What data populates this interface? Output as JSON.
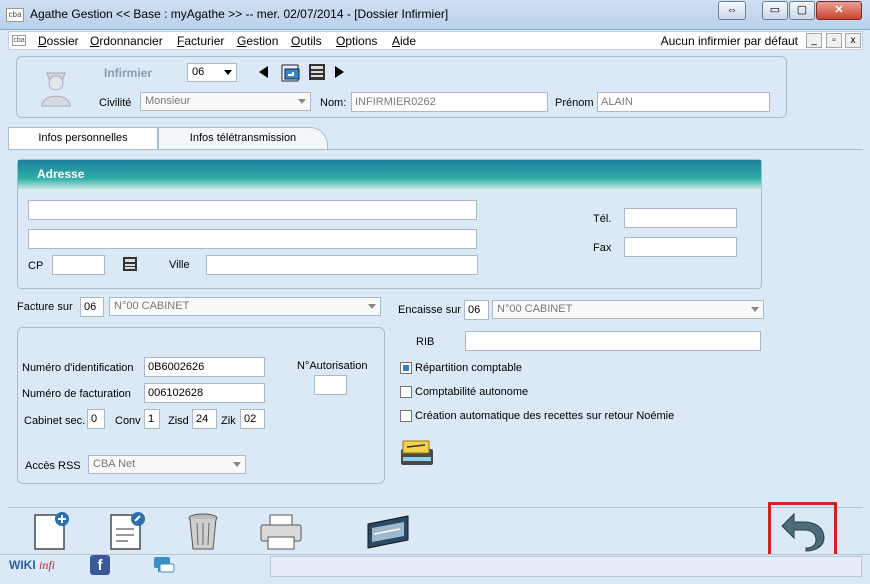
{
  "window": {
    "icon_text": "cba",
    "title": "Agathe Gestion << Base : myAgathe >>   --   mer. 02/07/2014  - [Dossier Infirmier]",
    "buttons": {
      "restore": "⇔",
      "minimize": "▭",
      "maximize": "▢",
      "close": "✕"
    }
  },
  "menubar": {
    "items": [
      {
        "first": "D",
        "rest": "ossier"
      },
      {
        "first": "O",
        "rest": "rdonnancier"
      },
      {
        "first": "F",
        "rest": "acturier"
      },
      {
        "first": "G",
        "rest": "estion"
      },
      {
        "first": "O",
        "rest": "utils"
      },
      {
        "first": "O",
        "rest": "ptions"
      },
      {
        "first": "A",
        "rest": "ide"
      }
    ],
    "right_label": "Aucun infirmier par défaut",
    "mdi": {
      "minimize": "_",
      "restore": "▫",
      "close": "x"
    }
  },
  "header": {
    "role_label": "Infirmier",
    "record_number": "06",
    "civilite_label": "Civilité",
    "civilite_value": "Monsieur",
    "nom_label": "Nom:",
    "nom_value": "INFIRMIER0262",
    "prenom_label": "Prénom",
    "prenom_value": "ALAIN"
  },
  "tabs": [
    {
      "label": "Infos personnelles",
      "active": true
    },
    {
      "label": "Infos télétransmission",
      "active": false
    }
  ],
  "adresse": {
    "title": "Adresse",
    "line1": "",
    "line2": "",
    "cp_label": "CP",
    "cp_value": "",
    "ville_label": "Ville",
    "ville_value": "",
    "tel_label": "Tél.",
    "tel_value": "",
    "fax_label": "Fax",
    "fax_value": ""
  },
  "facturation": {
    "facture_sur_label": "Facture sur",
    "facture_sur_code": "06",
    "facture_sur_value": "N°00  CABINET",
    "encaisse_sur_label": "Encaisse sur",
    "encaisse_sur_code": "06",
    "encaisse_sur_value": "N°00  CABINET",
    "rib_label": "RIB",
    "rib_value": ""
  },
  "identification": {
    "num_id_label": "Numéro d'identification",
    "num_id_value": "0B6002626",
    "num_fact_label": "Numéro de facturation",
    "num_fact_value": "006102628",
    "autorisation_label": "N°Autorisation",
    "autorisation_value": "",
    "cabinet_sec_label": "Cabinet sec.",
    "cabinet_sec_value": "0",
    "conv_label": "Conv",
    "conv_value": "1",
    "zisd_label": "Zisd",
    "zisd_value": "24",
    "zik_label": "Zik",
    "zik_value": "02",
    "acces_rss_label": "Accès RSS",
    "acces_rss_value": "CBA Net"
  },
  "options": [
    {
      "label": "Répartition comptable",
      "checked": true
    },
    {
      "label": "Comptabilité autonome",
      "checked": false
    },
    {
      "label": "Création automatique des recettes sur retour Noémie",
      "checked": false
    }
  ],
  "statusbar": {
    "wiki_a": "WIKI",
    "wiki_b": "infi",
    "facebook": "f"
  },
  "colors": {
    "accent_header": "#1f8fa8",
    "highlight_box": "#d62020",
    "background": "#dbe9f6"
  }
}
